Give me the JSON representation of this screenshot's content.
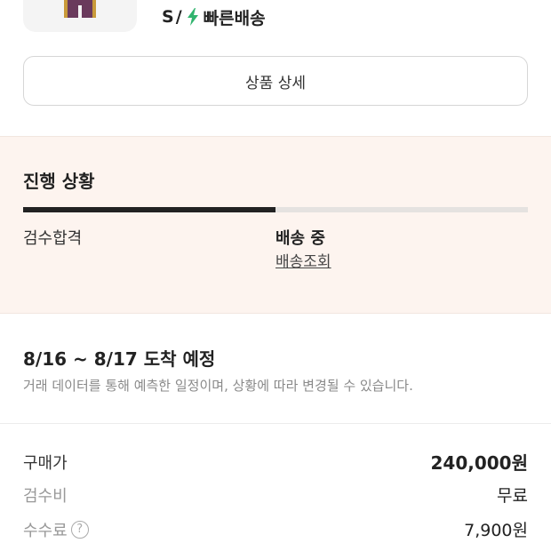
{
  "product": {
    "size": "S",
    "separator": "/",
    "delivery_type": "빠른배송",
    "delivery_icon": "bolt-icon",
    "accent_color": "#31b46e"
  },
  "detail_button": {
    "label": "상품 상세"
  },
  "progress": {
    "title": "진행 상황",
    "completed_fraction": 0.5,
    "steps": [
      {
        "label": "검수합격"
      },
      {
        "label": "배송 중"
      }
    ],
    "tracking_link": "배송조회"
  },
  "eta": {
    "title": "8/16 ~ 8/17 도착 예정",
    "description": "거래 데이터를 통해 예측한 일정이며, 상황에 따라 변경될 수 있습니다."
  },
  "summary": {
    "purchase_price_label": "구매가",
    "purchase_price": "240,000원",
    "inspection_fee_label": "검수비",
    "inspection_fee": "무료",
    "commission_label": "수수료",
    "commission_help": "?",
    "commission": "7,900원"
  }
}
